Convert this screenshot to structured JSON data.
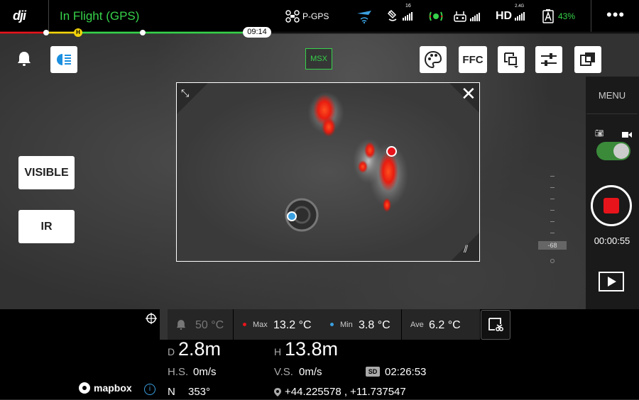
{
  "topbar": {
    "logo": "dji",
    "flight_status": "In Flight (GPS)",
    "mode": "P-GPS",
    "satellites": "16",
    "video_link": "HD",
    "video_band": "2.4G",
    "battery_pct": "43%",
    "flight_time": "09:14",
    "battery_level": 0.38
  },
  "left": {
    "visible_label": "VISIBLE",
    "ir_label": "IR"
  },
  "top_controls": {
    "msx_label": "MSX",
    "ffc_label": "FFC"
  },
  "right_panel": {
    "menu_label": "MENU",
    "record_timer": "00:00:55",
    "gimbal_value": "-68"
  },
  "temps": {
    "alarm": "50 °C",
    "max_label": "Max",
    "max_value": "13.2 °C",
    "min_label": "Min",
    "min_value": "3.8 °C",
    "ave_label": "Ave",
    "ave_value": "6.2 °C"
  },
  "telemetry": {
    "d_label": "D",
    "d_value": "2.8m",
    "h_label": "H",
    "h_value": "13.8m",
    "hs_label": "H.S.",
    "hs_value": "0m/s",
    "vs_label": "V.S.",
    "vs_value": "0m/s",
    "sd_label": "SD",
    "sd_time": "02:26:53",
    "heading_label": "N",
    "heading_value": "353°",
    "coords": "+44.225578 , +11.737547"
  },
  "map": {
    "brand": "mapbox"
  },
  "colors": {
    "flight_green": "#36d24a",
    "record_red": "#e8141b",
    "max_dot": "#e8141b",
    "min_dot": "#3aa0e0",
    "toggle_green": "#3a8a3a"
  }
}
